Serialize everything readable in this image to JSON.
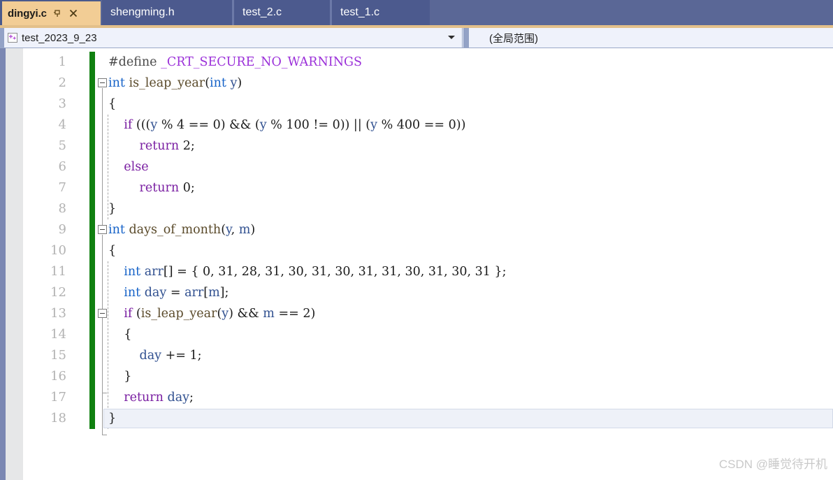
{
  "window": {
    "title": "dingyi.c - Visual Studio editor"
  },
  "tabs": {
    "items": [
      {
        "label": "dingyi.c",
        "active": true,
        "pin_icon": "pin-icon",
        "close_icon": "close-icon"
      },
      {
        "label": "shengming.h",
        "active": false
      },
      {
        "label": "test_2.c",
        "active": false
      },
      {
        "label": "test_1.c",
        "active": false
      }
    ]
  },
  "navbar": {
    "scope_icon": "cpp-file-icon",
    "scope_value": "test_2023_9_23",
    "scope_arrow_icon": "chevron-down-icon",
    "member_value": "(全局范围)"
  },
  "editor": {
    "language": "c",
    "lines": [
      {
        "n": "1",
        "indent": 0,
        "tokens": [
          {
            "t": "#define ",
            "c": "pp"
          },
          {
            "t": "_CRT_SECURE_NO_WARNINGS",
            "c": "macro"
          }
        ]
      },
      {
        "n": "2",
        "indent": 0,
        "tokens": [
          {
            "t": "int ",
            "c": "type"
          },
          {
            "t": "is_leap_year",
            "c": "func"
          },
          {
            "t": "(",
            "c": "plain"
          },
          {
            "t": "int ",
            "c": "type"
          },
          {
            "t": "y",
            "c": "ident"
          },
          {
            "t": ")",
            "c": "plain"
          }
        ]
      },
      {
        "n": "3",
        "indent": 0,
        "tokens": [
          {
            "t": "{",
            "c": "plain"
          }
        ]
      },
      {
        "n": "4",
        "indent": 0,
        "tokens": [
          {
            "t": "    ",
            "c": "plain"
          },
          {
            "t": "if",
            "c": "keyword"
          },
          {
            "t": " (((",
            "c": "plain"
          },
          {
            "t": "y",
            "c": "ident"
          },
          {
            "t": " % 4 == 0) && (",
            "c": "plain"
          },
          {
            "t": "y",
            "c": "ident"
          },
          {
            "t": " % 100 != 0)) || (",
            "c": "plain"
          },
          {
            "t": "y",
            "c": "ident"
          },
          {
            "t": " % 400 == 0))",
            "c": "plain"
          }
        ]
      },
      {
        "n": "5",
        "indent": 0,
        "tokens": [
          {
            "t": "        ",
            "c": "plain"
          },
          {
            "t": "return",
            "c": "keyword"
          },
          {
            "t": " 2;",
            "c": "plain"
          }
        ]
      },
      {
        "n": "6",
        "indent": 0,
        "tokens": [
          {
            "t": "    ",
            "c": "plain"
          },
          {
            "t": "else",
            "c": "keyword"
          }
        ]
      },
      {
        "n": "7",
        "indent": 0,
        "tokens": [
          {
            "t": "        ",
            "c": "plain"
          },
          {
            "t": "return",
            "c": "keyword"
          },
          {
            "t": " 0;",
            "c": "plain"
          }
        ]
      },
      {
        "n": "8",
        "indent": 0,
        "tokens": [
          {
            "t": "}",
            "c": "plain"
          }
        ]
      },
      {
        "n": "9",
        "indent": 0,
        "tokens": [
          {
            "t": "int ",
            "c": "type"
          },
          {
            "t": "days_of_month",
            "c": "func"
          },
          {
            "t": "(",
            "c": "plain"
          },
          {
            "t": "y",
            "c": "ident"
          },
          {
            "t": ", ",
            "c": "plain"
          },
          {
            "t": "m",
            "c": "ident"
          },
          {
            "t": ")",
            "c": "plain"
          }
        ]
      },
      {
        "n": "10",
        "indent": 0,
        "tokens": [
          {
            "t": "{",
            "c": "plain"
          }
        ]
      },
      {
        "n": "11",
        "indent": 0,
        "tokens": [
          {
            "t": "    ",
            "c": "plain"
          },
          {
            "t": "int ",
            "c": "type"
          },
          {
            "t": "arr",
            "c": "ident"
          },
          {
            "t": "[] = { 0, 31, 28, 31, 30, 31, 30, 31, 31, 30, 31, 30, 31 };",
            "c": "plain"
          }
        ]
      },
      {
        "n": "12",
        "indent": 0,
        "tokens": [
          {
            "t": "    ",
            "c": "plain"
          },
          {
            "t": "int ",
            "c": "type"
          },
          {
            "t": "day",
            "c": "ident"
          },
          {
            "t": " = ",
            "c": "plain"
          },
          {
            "t": "arr",
            "c": "ident"
          },
          {
            "t": "[",
            "c": "plain"
          },
          {
            "t": "m",
            "c": "ident"
          },
          {
            "t": "];",
            "c": "plain"
          }
        ]
      },
      {
        "n": "13",
        "indent": 0,
        "tokens": [
          {
            "t": "    ",
            "c": "plain"
          },
          {
            "t": "if",
            "c": "keyword"
          },
          {
            "t": " (",
            "c": "plain"
          },
          {
            "t": "is_leap_year",
            "c": "func"
          },
          {
            "t": "(",
            "c": "plain"
          },
          {
            "t": "y",
            "c": "ident"
          },
          {
            "t": ") && ",
            "c": "plain"
          },
          {
            "t": "m",
            "c": "ident"
          },
          {
            "t": " == 2)",
            "c": "plain"
          }
        ]
      },
      {
        "n": "14",
        "indent": 0,
        "tokens": [
          {
            "t": "    {",
            "c": "plain"
          }
        ]
      },
      {
        "n": "15",
        "indent": 0,
        "tokens": [
          {
            "t": "        ",
            "c": "plain"
          },
          {
            "t": "day",
            "c": "ident"
          },
          {
            "t": " += 1;",
            "c": "plain"
          }
        ]
      },
      {
        "n": "16",
        "indent": 0,
        "tokens": [
          {
            "t": "    }",
            "c": "plain"
          }
        ]
      },
      {
        "n": "17",
        "indent": 0,
        "tokens": [
          {
            "t": "    ",
            "c": "plain"
          },
          {
            "t": "return",
            "c": "keyword"
          },
          {
            "t": " ",
            "c": "plain"
          },
          {
            "t": "day",
            "c": "ident"
          },
          {
            "t": ";",
            "c": "plain"
          }
        ]
      },
      {
        "n": "18",
        "indent": 0,
        "tokens": [
          {
            "t": "}",
            "c": "plain"
          }
        ],
        "current": true
      }
    ],
    "folds": [
      {
        "line": 2,
        "span": 7
      },
      {
        "line": 9,
        "span": 10
      },
      {
        "line": 13,
        "span": 4
      }
    ]
  },
  "watermark": {
    "text": "CSDN @睡觉待开机"
  },
  "colors": {
    "tabstrip_bg": "#5a6796",
    "active_tab_bg": "#f2cd95",
    "inactive_tab_bg": "#4c5a8e",
    "gold_strip": "#e3c08a",
    "navbar_bg": "#eff2fb",
    "change_bar": "#108010",
    "keyword": "#7a1fa2",
    "type": "#1763c8",
    "macro": "#9b30d9",
    "identifier": "#2f4f8f",
    "current_line_bg": "#eef1f8"
  }
}
